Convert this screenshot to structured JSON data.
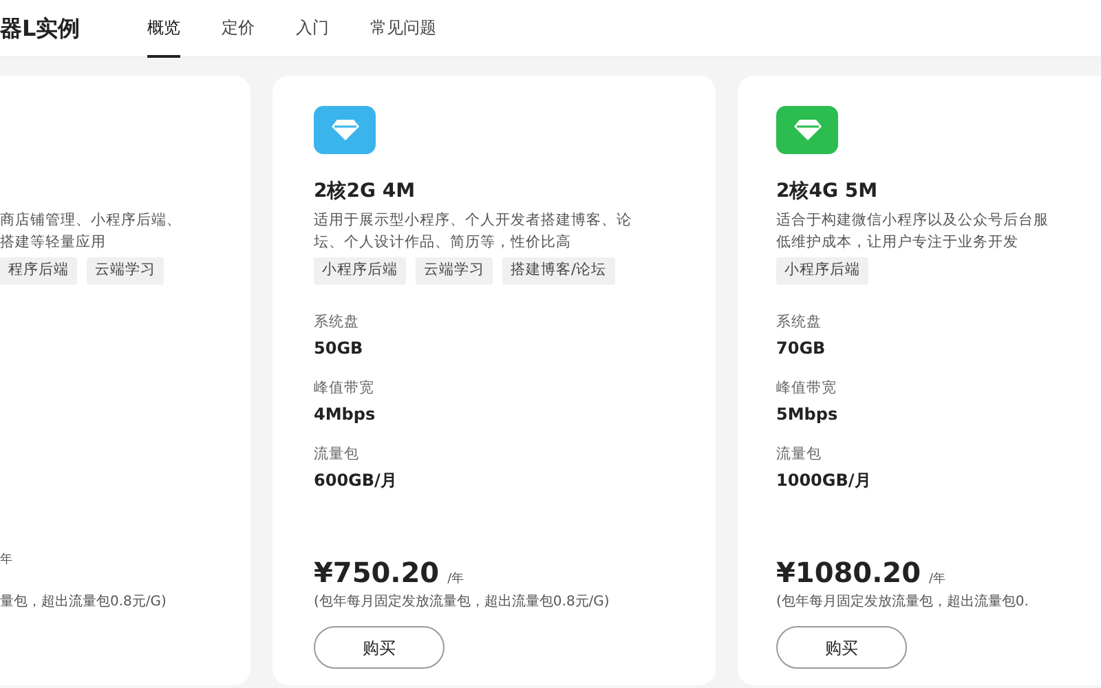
{
  "header": {
    "title": "器L实例",
    "tabs": [
      {
        "label": "概览",
        "selected": true
      },
      {
        "label": "定价",
        "selected": false
      },
      {
        "label": "入门",
        "selected": false
      },
      {
        "label": "常见问题",
        "selected": false
      }
    ]
  },
  "cards": [
    {
      "kind": "partial",
      "description_lines": [
        "商店铺管理、小程序后端、",
        "搭建等轻量应用"
      ],
      "tags": [
        "程序后端",
        "云端学习"
      ],
      "price_unit": "年",
      "note": "量包，超出流量包0.8元/G)"
    },
    {
      "kind": "full",
      "color": "#3bb4ec",
      "title": "2核2G 4M",
      "description_lines": [
        "适用于展示型小程序、个人开发者搭建博客、论",
        "坛、个人设计作品、简历等，性价比高"
      ],
      "tags": [
        "小程序后端",
        "云端学习",
        "搭建博客/论坛"
      ],
      "specs": [
        {
          "label": "系统盘",
          "value": "50GB"
        },
        {
          "label": "峰值带宽",
          "value": "4Mbps"
        },
        {
          "label": "流量包",
          "value": "600GB/月"
        }
      ],
      "price": "¥750.20",
      "price_unit": "/年",
      "note": "(包年每月固定发放流量包，超出流量包0.8元/G)",
      "button": "购买"
    },
    {
      "kind": "full",
      "color": "#2bbd4f",
      "title": "2核4G 5M",
      "description_lines": [
        "适合于构建微信小程序以及公众号后台服",
        "低维护成本，让用户专注于业务开发"
      ],
      "tags": [
        "小程序后端"
      ],
      "specs": [
        {
          "label": "系统盘",
          "value": "70GB"
        },
        {
          "label": "峰值带宽",
          "value": "5Mbps"
        },
        {
          "label": "流量包",
          "value": "1000GB/月"
        }
      ],
      "price": "¥1080.20",
      "price_unit": "/年",
      "note": "(包年每月固定发放流量包，超出流量包0.",
      "button": "购买"
    }
  ]
}
